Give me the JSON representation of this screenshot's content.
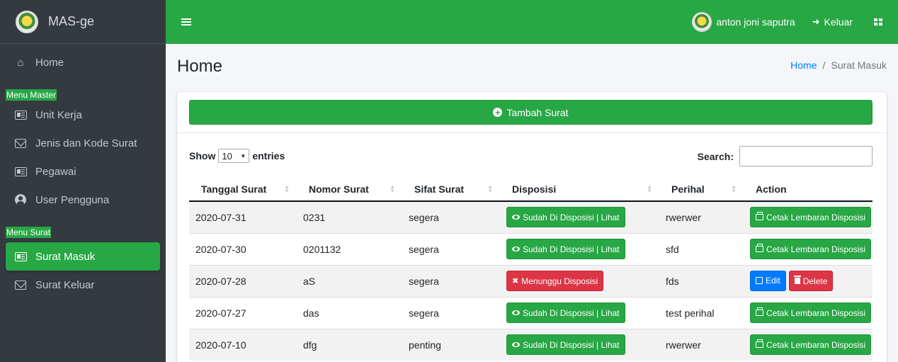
{
  "brand": {
    "name": "MAS-ge"
  },
  "sidebar": {
    "items": [
      {
        "label": "Home"
      },
      {
        "label": "Menu Master"
      },
      {
        "label": "Unit Kerja"
      },
      {
        "label": "Jenis dan Kode Surat"
      },
      {
        "label": "Pegawai"
      },
      {
        "label": "User Pengguna"
      },
      {
        "label": "Menu Surat"
      },
      {
        "label": "Surat Masuk"
      },
      {
        "label": "Surat Keluar"
      }
    ]
  },
  "topbar": {
    "user_name": "anton joni saputra",
    "logout_label": "Keluar"
  },
  "page": {
    "title": "Home"
  },
  "breadcrumb": {
    "home": "Home",
    "current": "Surat Masuk"
  },
  "card": {
    "add_button": "Tambah Surat"
  },
  "datatable": {
    "show_label": "Show",
    "entries_value": "10",
    "entries_label": "entries",
    "search_label": "Search:",
    "search_value": ""
  },
  "table": {
    "columns": [
      "Tanggal Surat",
      "Nomor Surat",
      "Sifat Surat",
      "Disposisi",
      "Perihal",
      "Action"
    ],
    "rows": [
      {
        "tanggal": "2020-07-31",
        "nomor": "0231",
        "sifat": "segera",
        "disposisi": "Sudah Di Disposisi | Lihat",
        "perihal": "rwerwer",
        "action": "Cetak Lembaran Disposisi"
      },
      {
        "tanggal": "2020-07-30",
        "nomor": "0201132",
        "sifat": "segera",
        "disposisi": "Sudah Di Disposisi | Lihat",
        "perihal": "sfd",
        "action": "Cetak Lembaran Disposisi"
      },
      {
        "tanggal": "2020-07-28",
        "nomor": "aS",
        "sifat": "segera",
        "disposisi": "Menunggu Disposisi",
        "perihal": "fds",
        "action_edit": "Edit",
        "action_delete": "Delete"
      },
      {
        "tanggal": "2020-07-27",
        "nomor": "das",
        "sifat": "segera",
        "disposisi": "Sudah Di Disposisi | Lihat",
        "perihal": "test perihal",
        "action": "Cetak Lembaran Disposisi"
      },
      {
        "tanggal": "2020-07-10",
        "nomor": "dfg",
        "sifat": "penting",
        "disposisi": "Sudah Di Disposisi | Lihat",
        "perihal": "rwerwer",
        "action": "Cetak Lembaran Disposisi"
      }
    ]
  },
  "colors": {
    "accent": "#28a745",
    "sidebar_bg": "#343a40",
    "danger": "#dc3545",
    "primary": "#007bff"
  },
  "icons": {
    "home": "home-icon",
    "unit_kerja": "id-card-icon",
    "jenis": "envelope-open-icon",
    "pegawai": "id-card-icon",
    "user": "user-circle-icon",
    "surat_masuk": "id-card-icon",
    "surat_keluar": "envelope-open-icon",
    "menu": "hamburger-icon",
    "logout": "sign-out-icon",
    "apps": "grid-icon",
    "add": "plus-circle-icon",
    "view": "eye-icon",
    "print": "print-icon",
    "wait": "times-icon",
    "edit": "edit-icon",
    "delete": "trash-icon"
  }
}
